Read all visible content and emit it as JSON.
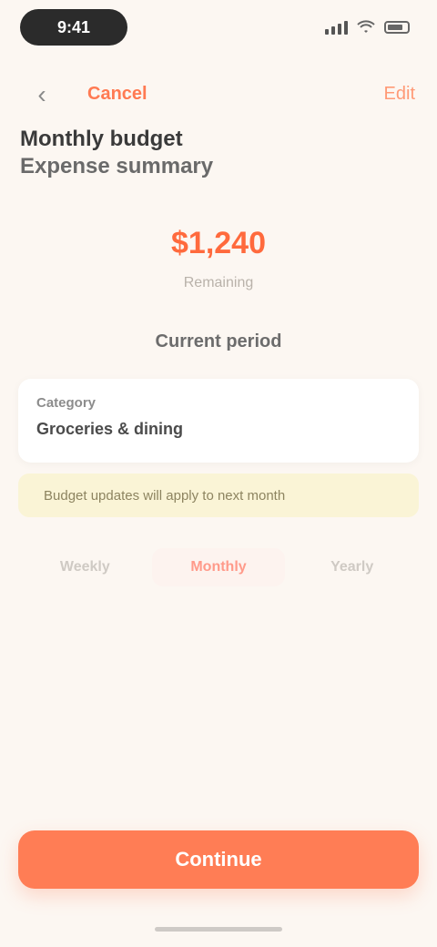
{
  "status_bar": {
    "time": "9:41"
  },
  "nav": {
    "back_icon": "chevron-left-icon",
    "left_link": "Cancel",
    "right_link": "Edit"
  },
  "title": {
    "line1": "Monthly budget",
    "line2": "Expense summary"
  },
  "summary": {
    "value": "$1,240",
    "caption": "Remaining",
    "section_label": "Current period"
  },
  "card": {
    "label": "Category",
    "value": "Groceries & dining"
  },
  "notice": {
    "text": "Budget updates will apply to next month"
  },
  "segments": {
    "items": [
      {
        "label": "Weekly"
      },
      {
        "label": "Monthly"
      },
      {
        "label": "Yearly"
      }
    ],
    "active_index": 1
  },
  "actions": {
    "primary_label": "Continue"
  },
  "colors": {
    "accent": "#ff7d55",
    "background": "#fcf7f2",
    "notice_bg": "#faf4d6",
    "card_bg": "#ffffff"
  }
}
